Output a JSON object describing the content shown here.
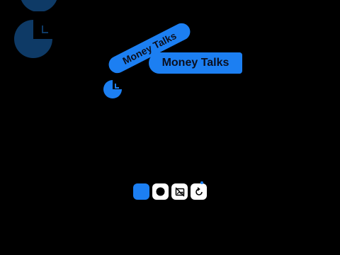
{
  "captions": {
    "tilted": "Money Talks",
    "straight": "Money Talks"
  },
  "controls": {
    "color_swatch": "blue",
    "record_icon": "record-icon",
    "media_icon": "image-slash-icon",
    "reset_icon": "reset-icon"
  },
  "colors": {
    "accent": "#1c7ff2",
    "dim_accent": "#0e3a66",
    "background": "#000000"
  }
}
